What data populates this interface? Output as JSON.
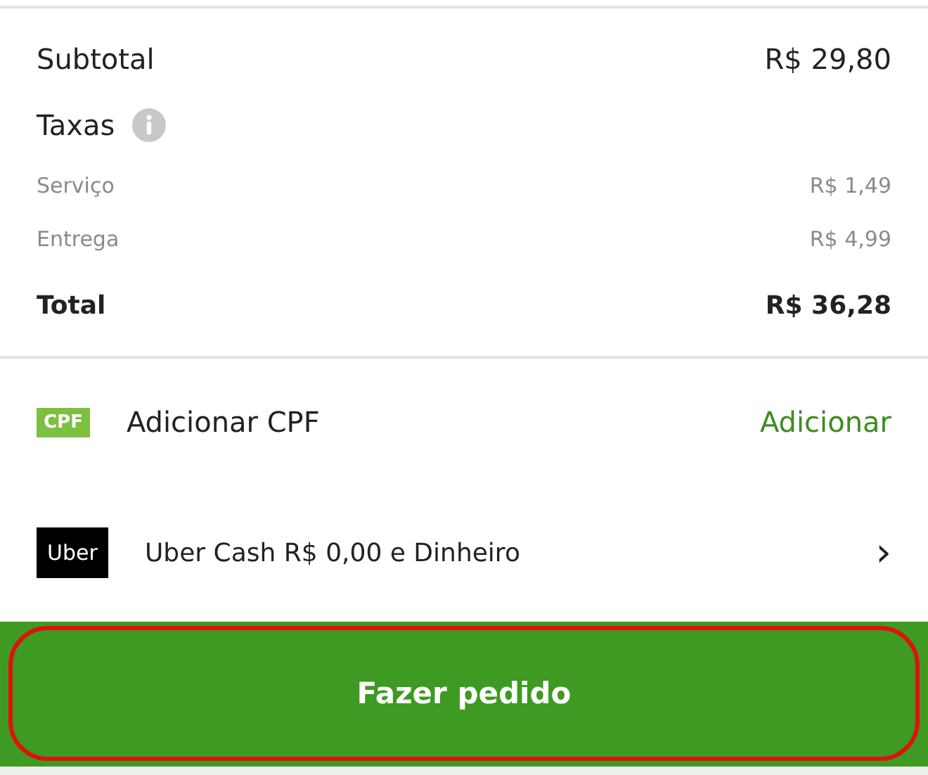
{
  "subtotal": {
    "label": "Subtotal",
    "value": "R$ 29,80"
  },
  "taxes": {
    "label": "Taxas",
    "items": [
      {
        "label": "Serviço",
        "value": "R$ 1,49"
      },
      {
        "label": "Entrega",
        "value": "R$ 4,99"
      }
    ]
  },
  "total": {
    "label": "Total",
    "value": "R$ 36,28"
  },
  "cpf": {
    "badge": "CPF",
    "label": "Adicionar CPF",
    "action": "Adicionar"
  },
  "payment": {
    "badge": "Uber",
    "label": "Uber Cash R$ 0,00 e Dinheiro",
    "chevron": "›"
  },
  "order_button": {
    "label": "Fazer pedido",
    "highlighted": true
  }
}
